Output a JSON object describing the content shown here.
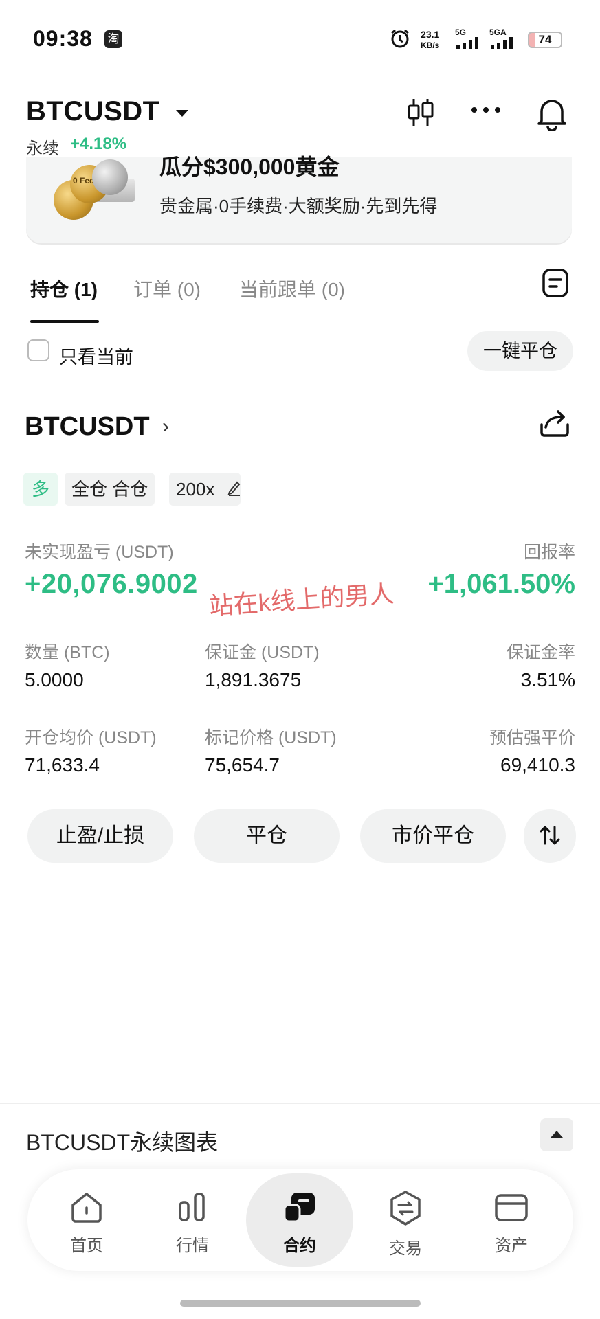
{
  "status_bar": {
    "time": "09:38",
    "app_badge": "淘",
    "net_speed_value": "23.1",
    "net_speed_unit": "KB/s",
    "signal1": "5G",
    "signal2": "5GA",
    "battery": "74"
  },
  "header": {
    "pair": "BTCUSDT",
    "contract_type": "永续",
    "change": "+4.18%"
  },
  "banner": {
    "title": "瓜分$300,000黄金",
    "subtitle": "贵金属·0手续费·大额奖励·先到先得",
    "coin_text": "0 Fees"
  },
  "tabs": [
    {
      "label": "持仓 (1)",
      "active": true
    },
    {
      "label": "订单 (0)",
      "active": false
    },
    {
      "label": "当前跟单 (0)",
      "active": false
    }
  ],
  "filter": {
    "only_current_label": "只看当前",
    "close_all_label": "一键平仓"
  },
  "position": {
    "symbol": "BTCUSDT",
    "side_tag": "多",
    "margin_mode_tag": "全仓 合仓",
    "leverage_tag": "200x",
    "unrealized_pnl_label": "未实现盈亏 (USDT)",
    "unrealized_pnl": "+20,076.9002",
    "roi_label": "回报率",
    "roi": "+1,061.50%",
    "watermark": "站在k线上的男人",
    "qty_label": "数量 (BTC)",
    "qty": "5.0000",
    "margin_label": "保证金 (USDT)",
    "margin": "1,891.3675",
    "margin_ratio_label": "保证金率",
    "margin_ratio": "3.51%",
    "entry_label": "开仓均价 (USDT)",
    "entry": "71,633.4",
    "mark_label": "标记价格 (USDT)",
    "mark": "75,654.7",
    "liq_label": "预估强平价",
    "liq": "69,410.3"
  },
  "actions": {
    "tp_sl": "止盈/止损",
    "close": "平仓",
    "market_close": "市价平仓"
  },
  "chart_bar": {
    "title": "BTCUSDT永续图表"
  },
  "bottom_nav": [
    {
      "label": "首页",
      "icon": "home-icon"
    },
    {
      "label": "行情",
      "icon": "market-icon"
    },
    {
      "label": "合约",
      "icon": "futures-icon",
      "active": true
    },
    {
      "label": "交易",
      "icon": "trade-icon"
    },
    {
      "label": "资产",
      "icon": "wallet-icon"
    }
  ],
  "colors": {
    "green": "#2ebd85",
    "watermark_red": "#e05a5a"
  }
}
